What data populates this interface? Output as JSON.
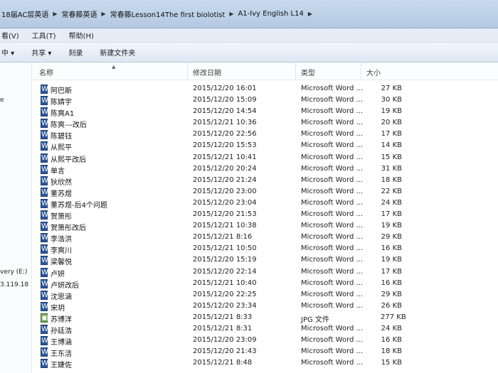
{
  "address": {
    "crumbs": [
      "18届AC层英语",
      "常春藤英语",
      "常春藤Lesson14The first biolotist",
      "A1-Ivy English L14"
    ]
  },
  "menubar": {
    "items": [
      "看(V)",
      "工具(T)",
      "帮助(H)"
    ]
  },
  "toolbar": {
    "items": [
      "中 ▾",
      "共享 ▾",
      "刻录",
      "新建文件夹"
    ]
  },
  "nav": {
    "items": [
      "e",
      "very (E:)",
      "3.119.18"
    ]
  },
  "columns": {
    "name": "名称",
    "date": "修改日期",
    "type": "类型",
    "size": "大小"
  },
  "files": [
    {
      "name": "阿巴斯",
      "date": "2015/12/20 16:01",
      "type": "Microsoft Word ...",
      "size": "27 KB",
      "icon": "word-doc-icon"
    },
    {
      "name": "陈婧宇",
      "date": "2015/12/20 15:09",
      "type": "Microsoft Word ...",
      "size": "30 KB",
      "icon": "word-doc-icon"
    },
    {
      "name": "陈爽A1",
      "date": "2015/12/20 14:54",
      "type": "Microsoft Word ...",
      "size": "19 KB",
      "icon": "word-doc-icon"
    },
    {
      "name": "陈爽---改后",
      "date": "2015/12/21 10:36",
      "type": "Microsoft Word ...",
      "size": "20 KB",
      "icon": "word-doc-icon"
    },
    {
      "name": "陈碧钰",
      "date": "2015/12/20 22:56",
      "type": "Microsoft Word ...",
      "size": "17 KB",
      "icon": "word-doc-icon"
    },
    {
      "name": "从熙平",
      "date": "2015/12/20 15:53",
      "type": "Microsoft Word ...",
      "size": "14 KB",
      "icon": "word-doc-icon"
    },
    {
      "name": "从熙平改后",
      "date": "2015/12/21 10:41",
      "type": "Microsoft Word ...",
      "size": "15 KB",
      "icon": "word-doc-icon"
    },
    {
      "name": "单言",
      "date": "2015/12/20 20:24",
      "type": "Microsoft Word ...",
      "size": "31 KB",
      "icon": "word-doc-icon"
    },
    {
      "name": "狄欣然",
      "date": "2015/12/20 21:24",
      "type": "Microsoft Word ...",
      "size": "18 KB",
      "icon": "word-doc-icon"
    },
    {
      "name": "董苏煜",
      "date": "2015/12/20 23:00",
      "type": "Microsoft Word ...",
      "size": "22 KB",
      "icon": "word-doc-icon"
    },
    {
      "name": "董苏煜-后4个问题",
      "date": "2015/12/20 23:04",
      "type": "Microsoft Word ...",
      "size": "24 KB",
      "icon": "word-doc-icon"
    },
    {
      "name": "贺箫彤",
      "date": "2015/12/20 21:53",
      "type": "Microsoft Word ...",
      "size": "17 KB",
      "icon": "word-doc-icon"
    },
    {
      "name": "贺箫彤改后",
      "date": "2015/12/21 10:38",
      "type": "Microsoft Word ...",
      "size": "19 KB",
      "icon": "word-doc-icon"
    },
    {
      "name": "李浩洪",
      "date": "2015/12/21 8:16",
      "type": "Microsoft Word ...",
      "size": "29 KB",
      "icon": "word-doc-icon"
    },
    {
      "name": "李爽川",
      "date": "2015/12/21 10:50",
      "type": "Microsoft Word ...",
      "size": "16 KB",
      "icon": "word-doc-icon"
    },
    {
      "name": "梁馨悦",
      "date": "2015/12/20 15:19",
      "type": "Microsoft Word ...",
      "size": "19 KB",
      "icon": "word-doc-icon"
    },
    {
      "name": "卢妍",
      "date": "2015/12/20 22:14",
      "type": "Microsoft Word ...",
      "size": "17 KB",
      "icon": "word-doc-icon"
    },
    {
      "name": "卢妍改后",
      "date": "2015/12/21 10:40",
      "type": "Microsoft Word ...",
      "size": "16 KB",
      "icon": "word-doc-icon"
    },
    {
      "name": "沈思涵",
      "date": "2015/12/20 22:25",
      "type": "Microsoft Word ...",
      "size": "29 KB",
      "icon": "word-doc-icon"
    },
    {
      "name": "宋玥",
      "date": "2015/12/20 23:34",
      "type": "Microsoft Word ...",
      "size": "26 KB",
      "icon": "word-doc-icon"
    },
    {
      "name": "苏博洋",
      "date": "2015/12/21 8:33",
      "type": "JPG 文件",
      "size": "277 KB",
      "icon": "jpg-image-icon"
    },
    {
      "name": "孙廷浩",
      "date": "2015/12/21 8:31",
      "type": "Microsoft Word ...",
      "size": "24 KB",
      "icon": "word-doc-icon"
    },
    {
      "name": "王博涵",
      "date": "2015/12/20 23:09",
      "type": "Microsoft Word ...",
      "size": "16 KB",
      "icon": "word-doc-icon"
    },
    {
      "name": "王东洁",
      "date": "2015/12/20 21:43",
      "type": "Microsoft Word ...",
      "size": "18 KB",
      "icon": "word-doc-icon"
    },
    {
      "name": "王婕佐",
      "date": "2015/12/21 8:48",
      "type": "Microsoft Word ...",
      "size": "15 KB",
      "icon": "word-doc-icon"
    }
  ]
}
